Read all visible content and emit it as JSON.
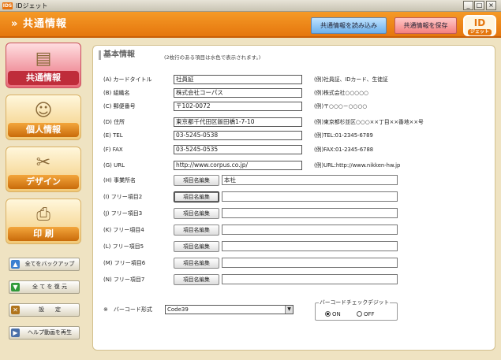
{
  "window": {
    "logo_text": "IDS",
    "title": "IDジェット",
    "min": "_",
    "max": "□",
    "close": "×"
  },
  "header": {
    "title": "共通情報",
    "load_button": "共通情報を読み込み",
    "save_button": "共通情報を保存",
    "logo": {
      "main": "ID",
      "sub": "ジェット"
    },
    "colors": {
      "orange": "#e5760d",
      "blue": "#6cb0ec",
      "red": "#f48080"
    }
  },
  "sidebar": {
    "nav": [
      {
        "label": "共通情報",
        "icon": "document-icon",
        "active": true
      },
      {
        "label": "個人情報",
        "icon": "person-icon",
        "active": false
      },
      {
        "label": "デザイン",
        "icon": "scissors-icon",
        "active": false
      },
      {
        "label": "印 刷",
        "icon": "printer-icon",
        "active": false
      }
    ],
    "buttons": [
      {
        "label": "全てをバックアップ",
        "icon": "backup-icon"
      },
      {
        "label": "全 て を 復 元",
        "icon": "restore-icon"
      },
      {
        "label": "設　　定",
        "icon": "settings-icon"
      },
      {
        "label": "ヘルプ動画を再生",
        "icon": "help-video-icon"
      }
    ]
  },
  "main": {
    "section_title": "基本情報",
    "section_note": "(2枚行のある項目は水色で表示されます。)",
    "fields": [
      {
        "label": "(A) カードタイトル",
        "value": "社員証",
        "example": "(例)社員証、IDカード、生徒証"
      },
      {
        "label": "(B) 組織名",
        "value": "株式会社コーパス",
        "example": "(例)株式会社○○○○○"
      },
      {
        "label": "(C) 郵便番号",
        "value": "〒102-0072",
        "example": "(例)〒○○○－○○○○"
      },
      {
        "label": "(D) 住所",
        "value": "東京都千代田区飯田橋1-7-10",
        "example": "(例)東京都杉並区○○○××丁目××番地××号"
      },
      {
        "label": "(E) TEL",
        "value": "03-5245-0538",
        "example": "(例)TEL:01-2345-6789"
      },
      {
        "label": "(F) FAX",
        "value": "03-5245-0535",
        "example": "(例)FAX:01-2345-6788"
      },
      {
        "label": "(G) URL",
        "value": "http://www.corpus.co.jp/",
        "example": "(例)URL:http://www.nikken-hw.jp"
      }
    ],
    "edit_button": "項目名編集",
    "items": [
      {
        "label": "(H) 事業所名",
        "value": "本社"
      },
      {
        "label": "(I) フリー項目2",
        "value": ""
      },
      {
        "label": "(J) フリー項目3",
        "value": ""
      },
      {
        "label": "(K) フリー項目4",
        "value": ""
      },
      {
        "label": "(L) フリー項目5",
        "value": ""
      },
      {
        "label": "(M) フリー項目6",
        "value": ""
      },
      {
        "label": "(N) フリー項目7",
        "value": ""
      }
    ],
    "barcode_label": "※　バーコード形式",
    "barcode_value": "Code39",
    "checkdigit": {
      "title": "バーコードチェックデジット",
      "on": "ON",
      "off": "OFF",
      "selected": "ON"
    }
  }
}
